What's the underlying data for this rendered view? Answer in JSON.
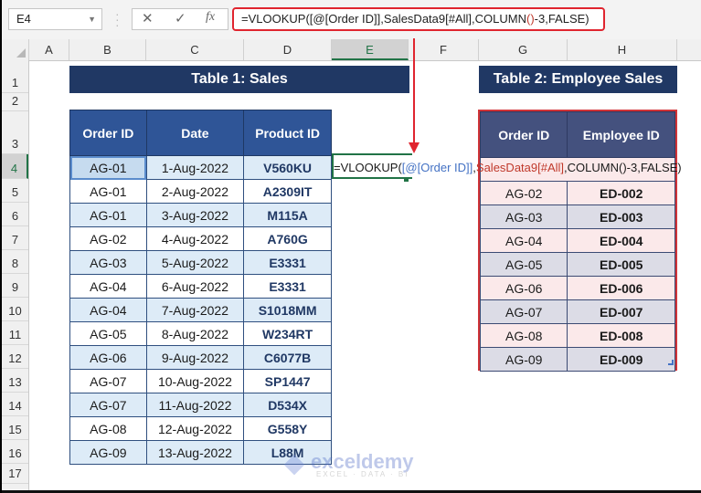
{
  "formula_bar": {
    "name_box": "E4",
    "cancel_icon": "✕",
    "enter_icon": "✓",
    "fx_label": "fx",
    "formula_parts": {
      "fn": "=VLOOKUP(",
      "ref1": "[@[Order ID]]",
      "comma1": ",",
      "ref2": "SalesData9[#All]",
      "rest1": ",COLUMN",
      "paren": "()",
      "rest2": "-3,FALSE)"
    }
  },
  "columns": [
    "A",
    "B",
    "C",
    "D",
    "E",
    "F",
    "G",
    "H"
  ],
  "rows": [
    "1",
    "2",
    "3",
    "4",
    "5",
    "6",
    "7",
    "8",
    "9",
    "10",
    "11",
    "12",
    "13",
    "14",
    "15",
    "16",
    "17"
  ],
  "table1": {
    "title": "Table 1: Sales",
    "headers": [
      "Order ID",
      "Date",
      "Product ID"
    ],
    "rows": [
      [
        "AG-01",
        "1-Aug-2022",
        "V560KU"
      ],
      [
        "AG-01",
        "2-Aug-2022",
        "A2309IT"
      ],
      [
        "AG-01",
        "3-Aug-2022",
        "M115A"
      ],
      [
        "AG-02",
        "4-Aug-2022",
        "A760G"
      ],
      [
        "AG-03",
        "5-Aug-2022",
        "E3331"
      ],
      [
        "AG-04",
        "6-Aug-2022",
        "E3331"
      ],
      [
        "AG-04",
        "7-Aug-2022",
        "S1018MM"
      ],
      [
        "AG-05",
        "8-Aug-2022",
        "W234RT"
      ],
      [
        "AG-06",
        "9-Aug-2022",
        "C6077B"
      ],
      [
        "AG-07",
        "10-Aug-2022",
        "SP1447"
      ],
      [
        "AG-07",
        "11-Aug-2022",
        "D534X"
      ],
      [
        "AG-08",
        "12-Aug-2022",
        "G558Y"
      ],
      [
        "AG-09",
        "13-Aug-2022",
        "L88M"
      ]
    ]
  },
  "table2": {
    "title": "Table 2: Employee Sales",
    "headers": [
      "Order ID",
      "Employee ID"
    ],
    "rows": [
      [
        "AG-02",
        "ED-002"
      ],
      [
        "AG-03",
        "ED-003"
      ],
      [
        "AG-04",
        "ED-004"
      ],
      [
        "AG-05",
        "ED-005"
      ],
      [
        "AG-06",
        "ED-006"
      ],
      [
        "AG-07",
        "ED-007"
      ],
      [
        "AG-08",
        "ED-008"
      ],
      [
        "AG-09",
        "ED-009"
      ]
    ]
  },
  "watermark": {
    "brand": "exceldemy",
    "tagline": "EXCEL · DATA · BI"
  },
  "colors": {
    "accent_red": "#e0252f",
    "header_navy": "#203864",
    "table1_header": "#2f5597",
    "table2_header": "#44517e",
    "excel_green": "#217346"
  }
}
